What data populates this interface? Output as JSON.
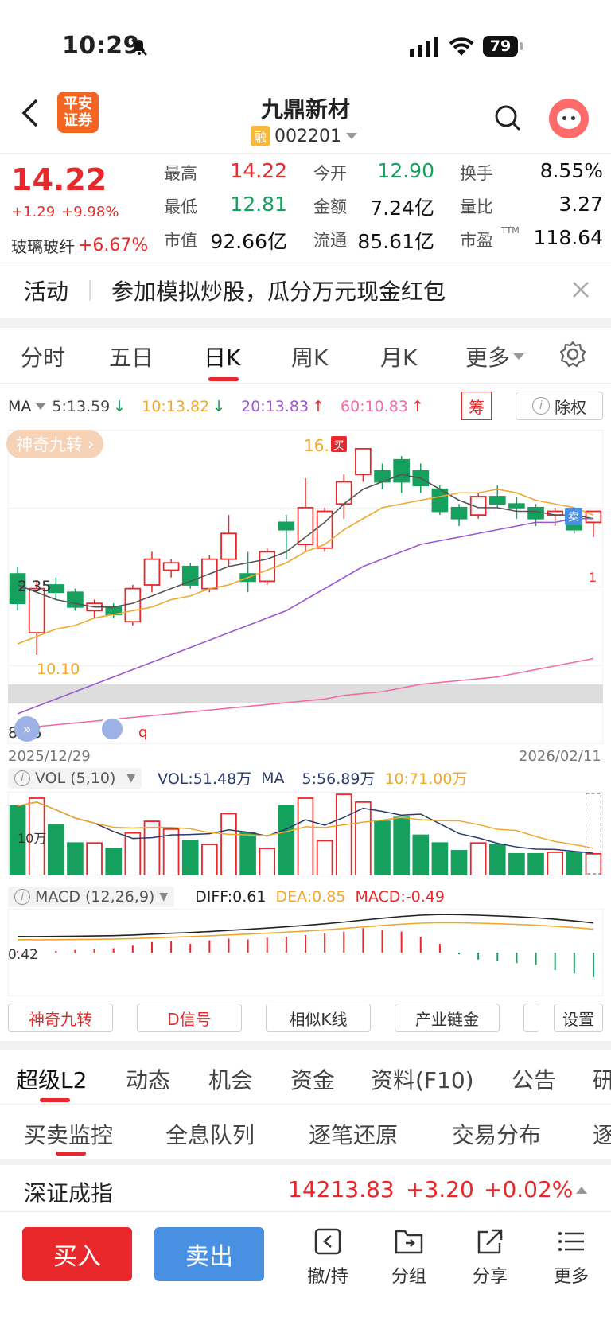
{
  "status": {
    "time": "10:29",
    "battery": "79"
  },
  "header": {
    "broker_logo_line1": "平安",
    "broker_logo_line2": "证券",
    "stock_name": "九鼎新材",
    "margin_badge": "融",
    "stock_code": "002201"
  },
  "quote": {
    "price": "14.22",
    "change": "+1.29",
    "change_pct": "+9.98%",
    "sector_name": "玻璃玻纤",
    "sector_change": "+6.67%",
    "fields": [
      [
        {
          "k": "最高",
          "v": "14.22",
          "c": "red"
        },
        {
          "k": "今开",
          "v": "12.90",
          "c": "green"
        },
        {
          "k": "换手",
          "v": "8.55%",
          "c": "dark"
        }
      ],
      [
        {
          "k": "最低",
          "v": "12.81",
          "c": "green"
        },
        {
          "k": "金额",
          "v": "7.24亿",
          "c": "dark"
        },
        {
          "k": "量比",
          "v": "3.27",
          "c": "dark"
        }
      ],
      [
        {
          "k": "市值",
          "v": "92.66亿",
          "c": "dark"
        },
        {
          "k": "流通",
          "v": "85.61亿",
          "c": "dark"
        },
        {
          "k": "市盈",
          "v": "118.64",
          "c": "dark"
        }
      ]
    ],
    "ttm": "TTM"
  },
  "banner": {
    "tag": "活动",
    "text": "参加模拟炒股，瓜分万元现金红包"
  },
  "period_tabs": [
    "分时",
    "五日",
    "日K",
    "周K",
    "月K",
    "更多"
  ],
  "ma_row": {
    "label": "MA",
    "ma5": "5:13.59",
    "ma10": "10:13.82",
    "ma20": "20:13.83",
    "ma60": "60:10.83",
    "chou": "筹",
    "exright": "除权"
  },
  "chart_labels": {
    "nine_turn": "神奇九转",
    "high_label": "16.",
    "sell_tag": "卖",
    "buy_tag": "买",
    "price_1": "2.35",
    "price_2": "10.10",
    "price_3": "8.56",
    "marker_1": "1",
    "marker_q": "q"
  },
  "dates": {
    "start": "2025/12/29",
    "end": "2026/02/11"
  },
  "vol_row": {
    "label": "VOL (5,10)",
    "vol": "VOL:51.48万",
    "ma": "MA",
    "ma5": "5:56.89万",
    "ma10": "10:71.00万",
    "axis": "10万"
  },
  "macd_row": {
    "label": "MACD (12,26,9)",
    "diff": "DIFF:0.61",
    "dea": "DEA:0.85",
    "macd": "MACD:-0.49",
    "axis": "0.42"
  },
  "tool_buttons": [
    "神奇九转",
    "D信号",
    "相似K线",
    "产业链金",
    "设置"
  ],
  "section_tabs": [
    "超级L2",
    "动态",
    "机会",
    "资金",
    "资料(F10)",
    "公告",
    "研"
  ],
  "sub_tabs": [
    "买卖监控",
    "全息队列",
    "逐笔还原",
    "交易分布",
    "逐"
  ],
  "index": {
    "name": "深证成指",
    "value": "14213.83",
    "change": "+3.20",
    "pct": "+0.02%"
  },
  "bottom": {
    "buy": "买入",
    "sell": "卖出",
    "items": [
      "撤/持",
      "分组",
      "分享",
      "更多"
    ]
  },
  "colors": {
    "up": "#e8282b",
    "down": "#16a05d",
    "ma5": "#555555",
    "ma10": "#f0a82c",
    "ma20": "#9b59d0",
    "ma60": "#f06ba8"
  },
  "chart_data": {
    "type": "candlestick",
    "y_range": [
      8.5,
      16.5
    ],
    "candles": [
      {
        "o": 12.8,
        "c": 12.0,
        "h": 13.0,
        "l": 11.8
      },
      {
        "o": 11.2,
        "c": 12.4,
        "h": 12.6,
        "l": 10.6
      },
      {
        "o": 12.5,
        "c": 12.3,
        "h": 12.7,
        "l": 12.1
      },
      {
        "o": 12.3,
        "c": 11.9,
        "h": 12.4,
        "l": 11.8
      },
      {
        "o": 11.8,
        "c": 12.0,
        "h": 12.1,
        "l": 11.6
      },
      {
        "o": 11.9,
        "c": 11.7,
        "h": 12.0,
        "l": 11.6
      },
      {
        "o": 11.5,
        "c": 12.4,
        "h": 12.5,
        "l": 11.4
      },
      {
        "o": 12.5,
        "c": 13.2,
        "h": 13.4,
        "l": 12.3
      },
      {
        "o": 12.9,
        "c": 13.1,
        "h": 13.2,
        "l": 12.7
      },
      {
        "o": 13.0,
        "c": 12.5,
        "h": 13.1,
        "l": 12.4
      },
      {
        "o": 12.4,
        "c": 13.2,
        "h": 13.3,
        "l": 12.3
      },
      {
        "o": 13.2,
        "c": 13.9,
        "h": 14.4,
        "l": 13.0
      },
      {
        "o": 12.8,
        "c": 12.6,
        "h": 13.4,
        "l": 12.3
      },
      {
        "o": 12.6,
        "c": 13.4,
        "h": 13.5,
        "l": 12.5
      },
      {
        "o": 14.2,
        "c": 14.0,
        "h": 14.4,
        "l": 13.2
      },
      {
        "o": 13.6,
        "c": 14.6,
        "h": 15.4,
        "l": 13.4
      },
      {
        "o": 13.5,
        "c": 14.5,
        "h": 14.6,
        "l": 13.4
      },
      {
        "o": 14.7,
        "c": 15.3,
        "h": 15.5,
        "l": 14.3
      },
      {
        "o": 15.5,
        "c": 16.2,
        "h": 16.2,
        "l": 15.3
      },
      {
        "o": 15.6,
        "c": 15.3,
        "h": 15.8,
        "l": 15.1
      },
      {
        "o": 15.9,
        "c": 15.3,
        "h": 16.0,
        "l": 15.0
      },
      {
        "o": 15.6,
        "c": 15.2,
        "h": 15.8,
        "l": 15.0
      },
      {
        "o": 15.1,
        "c": 14.5,
        "h": 15.2,
        "l": 14.4
      },
      {
        "o": 14.6,
        "c": 14.3,
        "h": 14.7,
        "l": 14.1
      },
      {
        "o": 14.4,
        "c": 14.9,
        "h": 15.0,
        "l": 14.3
      },
      {
        "o": 14.9,
        "c": 14.7,
        "h": 15.2,
        "l": 14.6
      },
      {
        "o": 14.7,
        "c": 14.6,
        "h": 14.9,
        "l": 14.3
      },
      {
        "o": 14.6,
        "c": 14.3,
        "h": 14.7,
        "l": 14.1
      },
      {
        "o": 14.4,
        "c": 14.5,
        "h": 14.6,
        "l": 14.1
      },
      {
        "o": 14.4,
        "c": 14.0,
        "h": 14.5,
        "l": 13.9
      },
      {
        "o": 14.2,
        "c": 14.5,
        "h": 14.5,
        "l": 13.8
      }
    ],
    "volumes": [
      0.9,
      1.0,
      0.65,
      0.42,
      0.42,
      0.35,
      0.55,
      0.7,
      0.6,
      0.45,
      0.4,
      0.8,
      0.55,
      0.35,
      0.9,
      1.0,
      0.45,
      1.05,
      0.95,
      0.7,
      0.75,
      0.52,
      0.42,
      0.32,
      0.42,
      0.4,
      0.28,
      0.28,
      0.3,
      0.3,
      0.28
    ],
    "macd_bars": [
      0.02,
      -0.01,
      0.02,
      0.03,
      0.04,
      0.05,
      0.08,
      0.12,
      0.13,
      0.1,
      0.14,
      0.16,
      0.15,
      0.17,
      0.18,
      0.2,
      0.22,
      0.24,
      0.28,
      0.26,
      0.24,
      0.18,
      0.1,
      -0.02,
      -0.08,
      -0.1,
      -0.12,
      -0.14,
      -0.2,
      -0.24,
      -0.28
    ],
    "ma5": [
      12.5,
      12.3,
      12.1,
      12.0,
      11.9,
      11.9,
      12.0,
      12.2,
      12.4,
      12.6,
      12.8,
      13.0,
      13.1,
      13.2,
      13.4,
      13.8,
      14.2,
      14.7,
      15.1,
      15.3,
      15.5,
      15.4,
      15.1,
      14.8,
      14.6,
      14.6,
      14.5,
      14.5,
      14.4,
      14.4,
      14.3
    ],
    "ma10": [
      10.9,
      11.1,
      11.3,
      11.4,
      11.6,
      11.7,
      11.8,
      11.9,
      12.1,
      12.2,
      12.4,
      12.5,
      12.7,
      12.9,
      13.1,
      13.4,
      13.6,
      14.0,
      14.3,
      14.6,
      14.7,
      14.8,
      14.9,
      15.0,
      15.0,
      15.1,
      15.0,
      14.8,
      14.7,
      14.6,
      14.4
    ],
    "ma20": [
      9.0,
      9.2,
      9.4,
      9.6,
      9.8,
      10.0,
      10.2,
      10.4,
      10.6,
      10.8,
      11.0,
      11.2,
      11.4,
      11.6,
      11.8,
      12.1,
      12.4,
      12.7,
      13.0,
      13.2,
      13.4,
      13.6,
      13.7,
      13.8,
      13.9,
      14.0,
      14.1,
      14.2,
      14.2,
      14.3,
      14.3
    ],
    "ma60": [
      8.6,
      8.65,
      8.7,
      8.75,
      8.8,
      8.85,
      8.9,
      8.95,
      9.0,
      9.05,
      9.1,
      9.15,
      9.2,
      9.25,
      9.3,
      9.35,
      9.4,
      9.5,
      9.55,
      9.6,
      9.7,
      9.8,
      9.85,
      9.9,
      9.95,
      10.0,
      10.1,
      10.2,
      10.3,
      10.4,
      10.5
    ]
  }
}
